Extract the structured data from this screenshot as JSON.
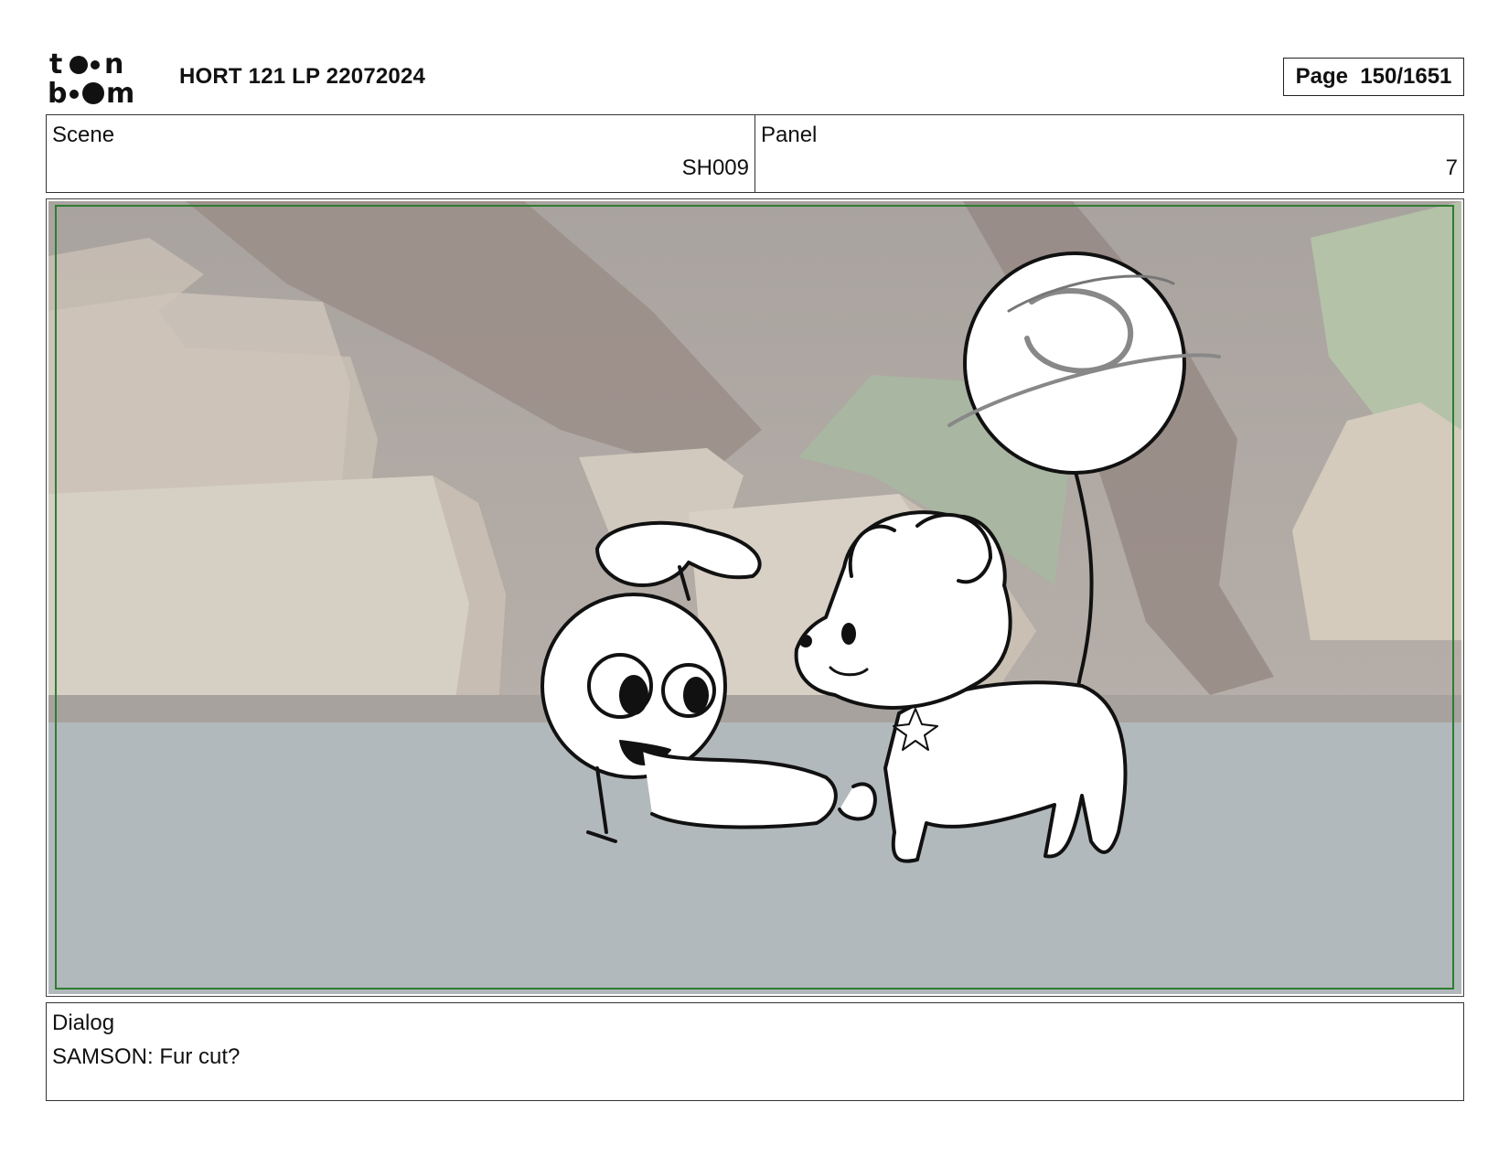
{
  "header": {
    "logo_text": "toon boom",
    "project_title": "HORT 121 LP 22072024",
    "page_label": "Page  150/1651"
  },
  "scene": {
    "label": "Scene",
    "value": "SH009"
  },
  "panel": {
    "label": "Panel",
    "value": "7"
  },
  "panel_image": {
    "description_icon": "storyboard-panel-image",
    "safe_area_color": "#2e7d32"
  },
  "dialog": {
    "label": "Dialog",
    "text": "SAMSON: Fur cut?"
  }
}
